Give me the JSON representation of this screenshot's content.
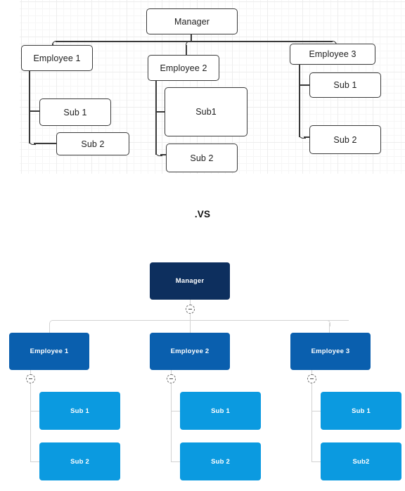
{
  "comparison": {
    "separator_label": ".VS"
  },
  "top_diagram": {
    "name": "original-org-chart",
    "style": "outlined-boxes-on-grid",
    "nodes": {
      "manager": "Manager",
      "employee1": "Employee 1",
      "employee1_sub1": "Sub 1",
      "employee1_sub2": "Sub 2",
      "employee2": "Employee 2",
      "employee2_sub1": "Sub1",
      "employee2_sub2": "Sub 2",
      "employee3": "Employee 3",
      "employee3_sub1": "Sub 1",
      "employee3_sub2": "Sub 2"
    },
    "colors": {
      "box_fill": "#ffffff",
      "box_border": "#3a3a3a",
      "text": "#1d1d1d",
      "grid_line": "#ededed"
    }
  },
  "bottom_diagram": {
    "name": "redesigned-org-chart",
    "style": "filled-blue-boxes",
    "nodes": {
      "manager": "Manager",
      "employee1": "Employee 1",
      "employee1_sub1": "Sub 1",
      "employee1_sub2": "Sub 2",
      "employee2": "Employee 2",
      "employee2_sub1": "Sub 1",
      "employee2_sub2": "Sub 2",
      "employee3": "Employee 3",
      "employee3_sub1": "Sub 1",
      "employee3_sub2": "Sub2"
    },
    "colors": {
      "root_fill": "#0d2f5e",
      "mid_fill": "#0a5fae",
      "leaf_fill": "#0b9ae0",
      "text": "#ffffff",
      "connector": "#d3d3d3"
    },
    "collapse_icon": "minus-circle-icon"
  }
}
